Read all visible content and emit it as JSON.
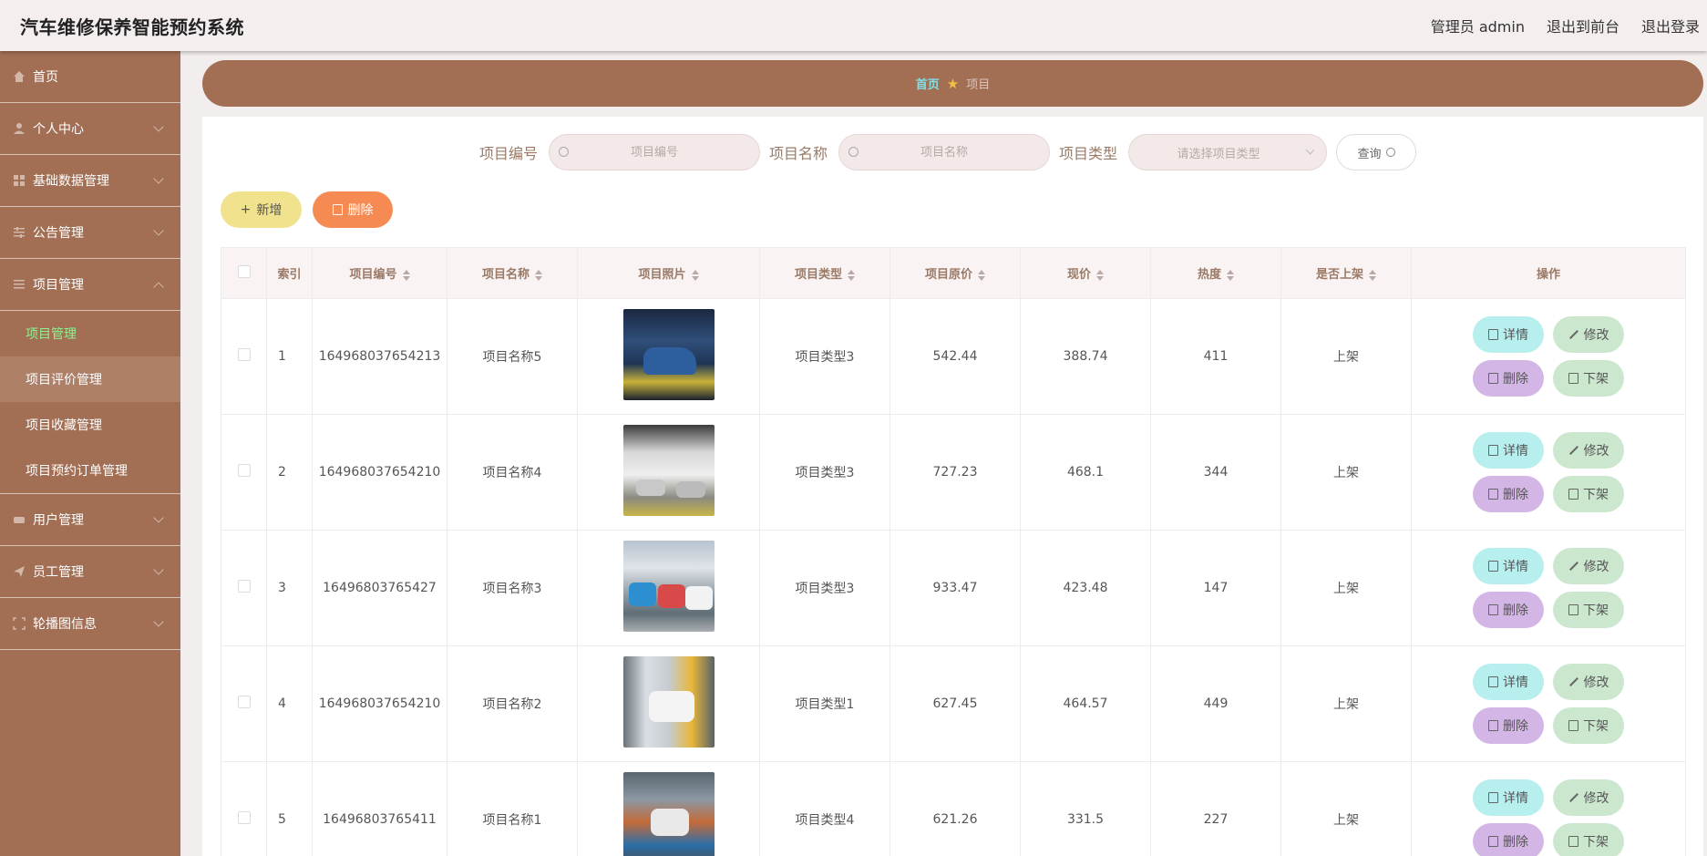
{
  "header": {
    "title": "汽车维修保养智能预约系统",
    "admin_label": "管理员 admin",
    "front_label": "退出到前台",
    "logout_label": "退出登录"
  },
  "sidebar": {
    "items": [
      {
        "label": "首页",
        "icon": "home-icon"
      },
      {
        "label": "个人中心",
        "icon": "user-icon"
      },
      {
        "label": "基础数据管理",
        "icon": "grid-icon"
      },
      {
        "label": "公告管理",
        "icon": "sliders-icon"
      },
      {
        "label": "项目管理",
        "icon": "list-icon"
      },
      {
        "label": "用户管理",
        "icon": "users-icon"
      },
      {
        "label": "员工管理",
        "icon": "send-icon"
      },
      {
        "label": "轮播图信息",
        "icon": "frame-icon"
      }
    ],
    "sub_items": [
      "项目管理",
      "项目评价管理",
      "项目收藏管理",
      "项目预约订单管理"
    ]
  },
  "breadcrumb": {
    "home": "首页",
    "current": "项目"
  },
  "search": {
    "code_label": "项目编号",
    "code_placeholder": "项目编号",
    "name_label": "项目名称",
    "name_placeholder": "项目名称",
    "type_label": "项目类型",
    "type_placeholder": "请选择项目类型",
    "query_label": "查询"
  },
  "toolbar": {
    "add_label": "新增",
    "delete_label": "删除"
  },
  "table": {
    "headers": [
      "索引",
      "项目编号",
      "项目名称",
      "项目照片",
      "项目类型",
      "项目原价",
      "现价",
      "热度",
      "是否上架",
      "操作"
    ],
    "rows": [
      {
        "index": "1",
        "code": "164968037654213",
        "name": "项目名称5",
        "type": "项目类型3",
        "price": "542.44",
        "now": "388.74",
        "heat": "411",
        "status": "上架"
      },
      {
        "index": "2",
        "code": "164968037654210",
        "name": "项目名称4",
        "type": "项目类型3",
        "price": "727.23",
        "now": "468.1",
        "heat": "344",
        "status": "上架"
      },
      {
        "index": "3",
        "code": "16496803765427",
        "name": "项目名称3",
        "type": "项目类型3",
        "price": "933.47",
        "now": "423.48",
        "heat": "147",
        "status": "上架"
      },
      {
        "index": "4",
        "code": "164968037654210",
        "name": "项目名称2",
        "type": "项目类型1",
        "price": "627.45",
        "now": "464.57",
        "heat": "449",
        "status": "上架"
      },
      {
        "index": "5",
        "code": "16496803765411",
        "name": "项目名称1",
        "type": "项目类型4",
        "price": "621.26",
        "now": "331.5",
        "heat": "227",
        "status": "上架"
      }
    ],
    "ops": {
      "detail": "详情",
      "edit": "修改",
      "remove": "删除",
      "down": "下架"
    }
  },
  "colors": {
    "sidebar": "#a26f55",
    "active_sub": "#8ff28f",
    "add": "#f1e28d",
    "delete": "#f58a52"
  }
}
